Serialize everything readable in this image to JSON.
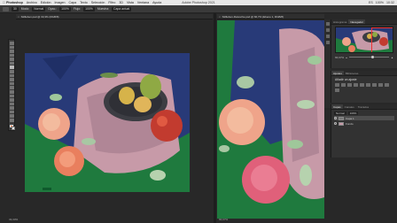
{
  "menubar": {
    "apple": "",
    "items": [
      "Photoshop",
      "Archivo",
      "Edición",
      "Imagen",
      "Capa",
      "Texto",
      "Selección",
      "Filtro",
      "3D",
      "Vista",
      "Ventana",
      "Ayuda"
    ],
    "app_title": "Adobe Photoshop 2021",
    "right": [
      "ES",
      "100%",
      "10:32"
    ]
  },
  "optionsbar": {
    "size": "30",
    "mode_label": "Modo:",
    "mode": "Normal",
    "opacity_label": "Opac.:",
    "opacity": "100%",
    "flow_label": "Flujo:",
    "flow": "100%",
    "sample_label": "Muestra:",
    "sample": "Capa actual"
  },
  "documents": {
    "left_tab": "Stillleben.psd @ 33,3% (RGB/8)",
    "right_tab": "Stillleben-Retusche.psd @ 66,7% (Ebene 1, RGB/8)",
    "left_status": "33,33%",
    "right_status": "66,67%"
  },
  "navigator": {
    "tabs": [
      "Histograma",
      "Navegador"
    ],
    "zoom": "66,67%",
    "zoom_fraction": 0.55
  },
  "adjustments": {
    "tabs": [
      "Ajustes",
      "Bibliotecas"
    ],
    "title": "Añadir un ajuste"
  },
  "layers": {
    "tabs": [
      "Capas",
      "Canales",
      "Trazados"
    ],
    "blend": "Normal",
    "opacity": "100%",
    "rows": [
      {
        "name": "Capa 1",
        "selected": true
      },
      {
        "name": "Fondo",
        "selected": false
      }
    ]
  },
  "colors": {
    "foreground": "#e86b3a",
    "background": "#ffffff",
    "accent": "#3478f6"
  }
}
